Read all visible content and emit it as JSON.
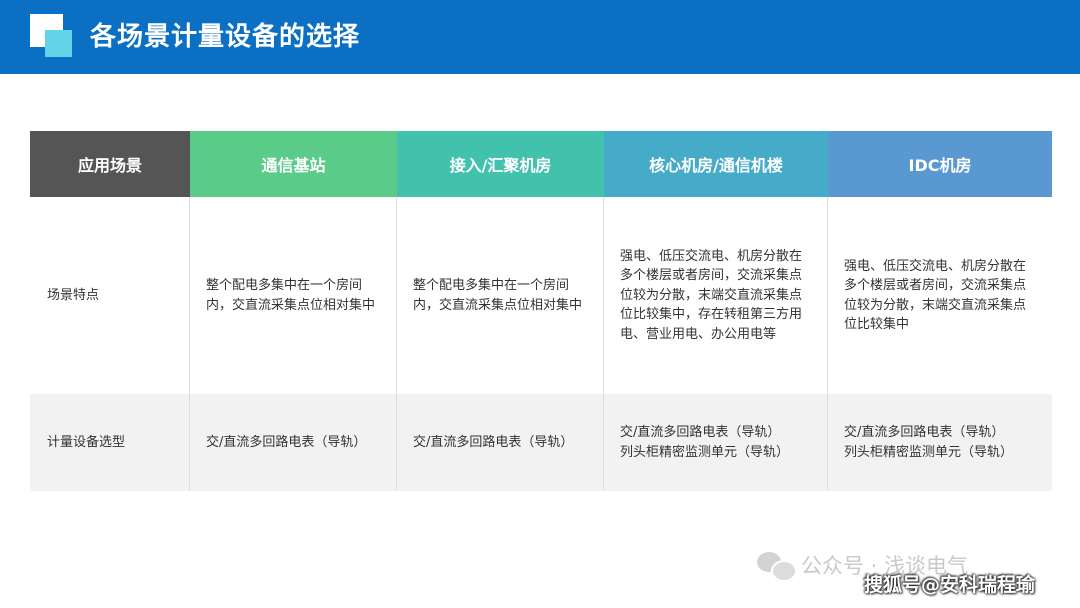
{
  "header": {
    "title": "各场景计量设备的选择"
  },
  "table": {
    "columns": [
      "应用场景",
      "通信基站",
      "接入/汇聚机房",
      "核心机房/通信机楼",
      "IDC机房"
    ],
    "rows": [
      {
        "label": "场景特点",
        "cells": [
          "整个配电多集中在一个房间内，交直流采集点位相对集中",
          "整个配电多集中在一个房间内，交直流采集点位相对集中",
          "强电、低压交流电、机房分散在多个楼层或者房间，交流采集点位较为分散，末端交直流采集点位比较集中，存在转租第三方用电、营业用电、办公用电等",
          "强电、低压交流电、机房分散在多个楼层或者房间，交流采集点位较为分散，末端交直流采集点位比较集中"
        ]
      },
      {
        "label": "计量设备选型",
        "cells": [
          "交/直流多回路电表（导轨）",
          "交/直流多回路电表（导轨）",
          "交/直流多回路电表（导轨）\n列头柜精密监测单元（导轨）",
          "交/直流多回路电表（导轨）\n列头柜精密监测单元（导轨）"
        ]
      }
    ]
  },
  "watermarks": {
    "wechat": "公众号 · 浅谈电气",
    "sohu": "搜狐号@安科瑞程瑜"
  }
}
